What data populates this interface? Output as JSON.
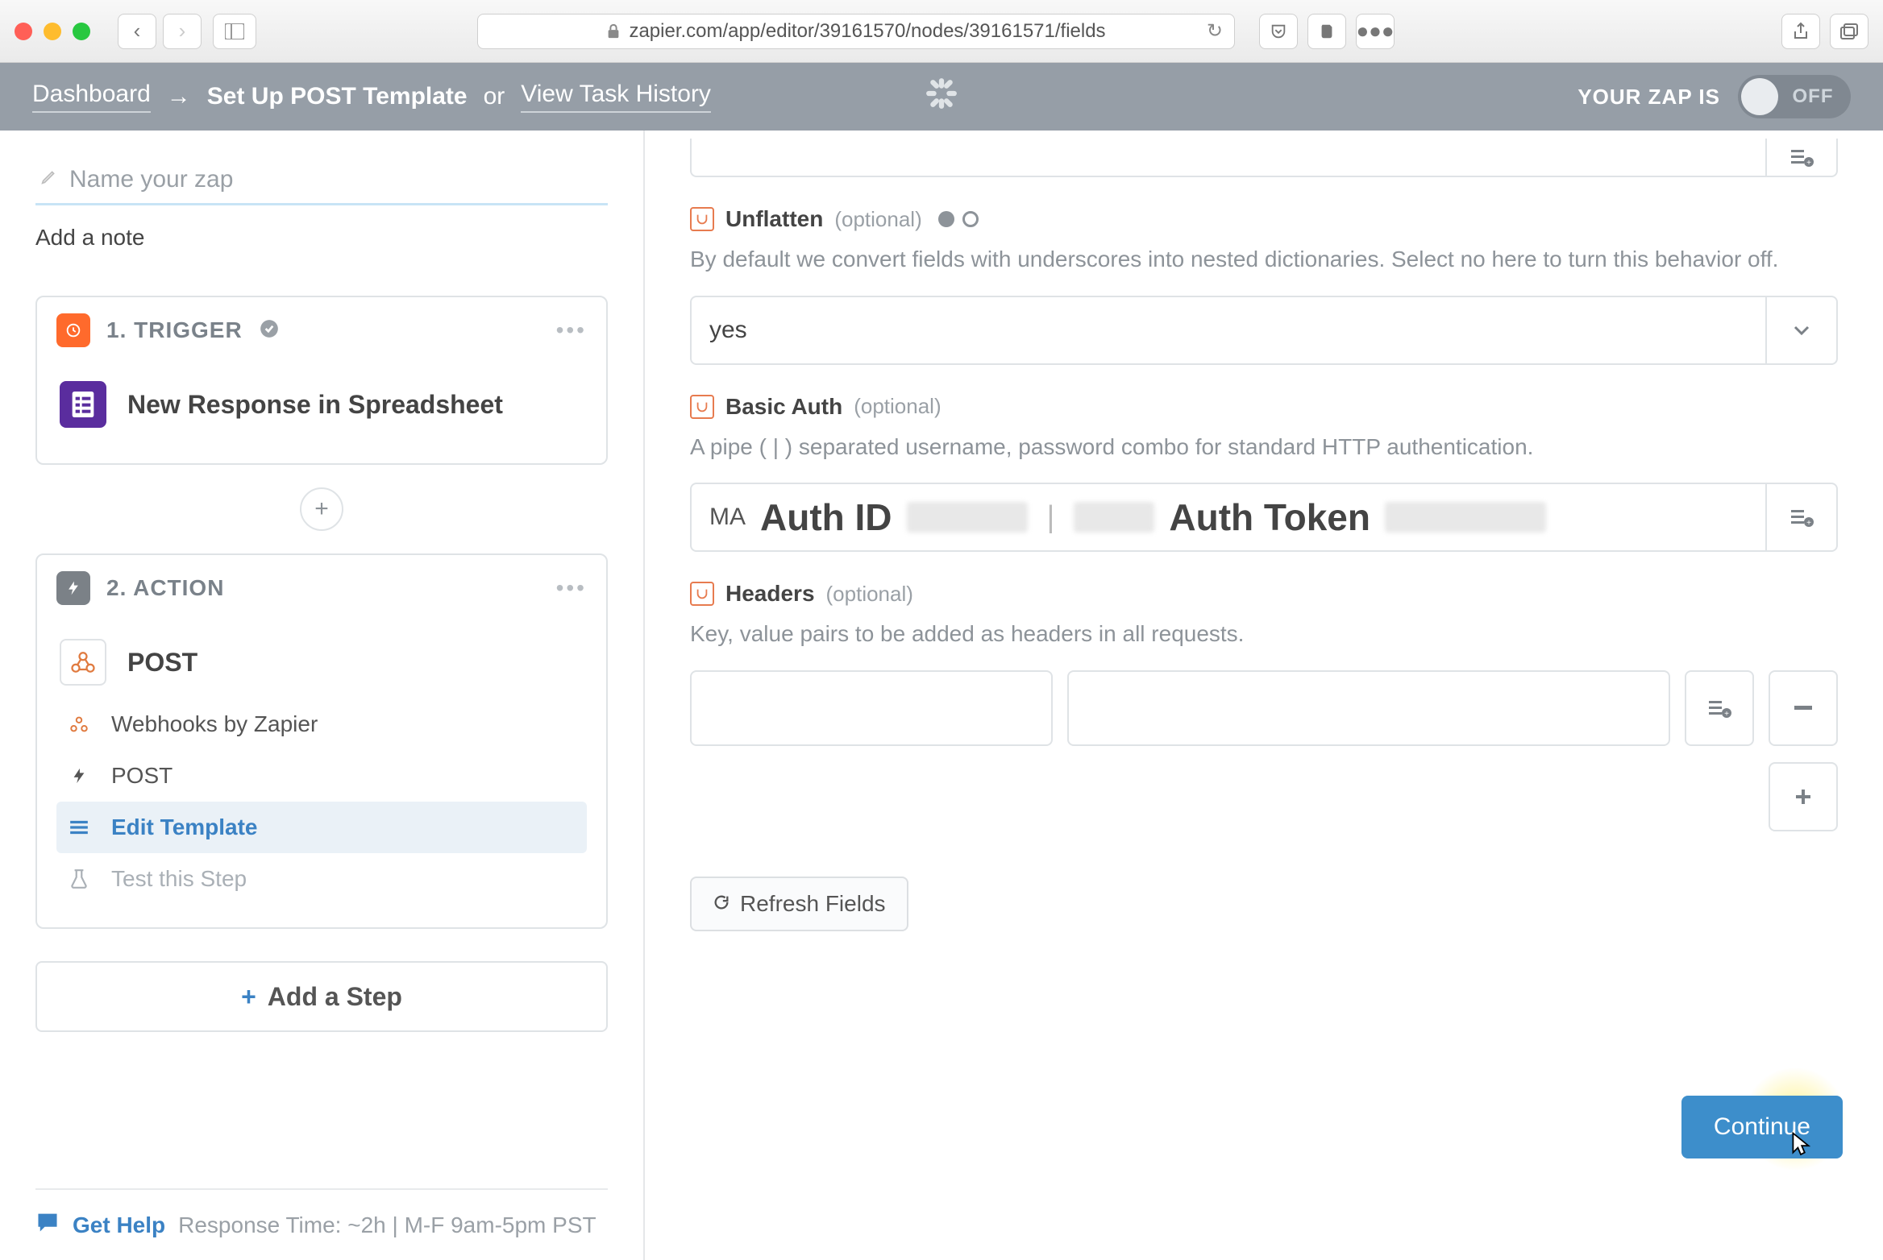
{
  "browser": {
    "url": "zapier.com/app/editor/39161570/nodes/39161571/fields"
  },
  "header": {
    "dashboard": "Dashboard",
    "current": "Set Up POST Template",
    "or": "or",
    "history": "View Task History",
    "zap_is": "YOUR ZAP IS",
    "toggle": "OFF"
  },
  "sidebar": {
    "name_placeholder": "Name your zap",
    "add_note": "Add a note",
    "trigger": {
      "label": "1. TRIGGER",
      "app": "New Response in Spreadsheet"
    },
    "action": {
      "label": "2. ACTION",
      "app": "POST",
      "substeps": {
        "webhooks": "Webhooks by Zapier",
        "post": "POST",
        "edit": "Edit Template",
        "test": "Test this Step"
      }
    },
    "add_step": "Add a Step",
    "help": {
      "label": "Get Help",
      "meta": "Response Time: ~2h | M-F 9am-5pm PST"
    }
  },
  "form": {
    "unflatten": {
      "label": "Unflatten",
      "optional": "(optional)",
      "help": "By default we convert fields with underscores into nested dictionaries. Select no here to turn this behavior off.",
      "value": "yes"
    },
    "basic_auth": {
      "label": "Basic Auth",
      "optional": "(optional)",
      "help": "A pipe (  |  ) separated username, password combo for standard HTTP authentication.",
      "prefix": "MA",
      "id_label": "Auth ID",
      "token_label": "Auth Token"
    },
    "headers": {
      "label": "Headers",
      "optional": "(optional)",
      "help": "Key, value pairs to be added as headers in all requests."
    },
    "refresh": "Refresh Fields",
    "continue": "Continue"
  }
}
